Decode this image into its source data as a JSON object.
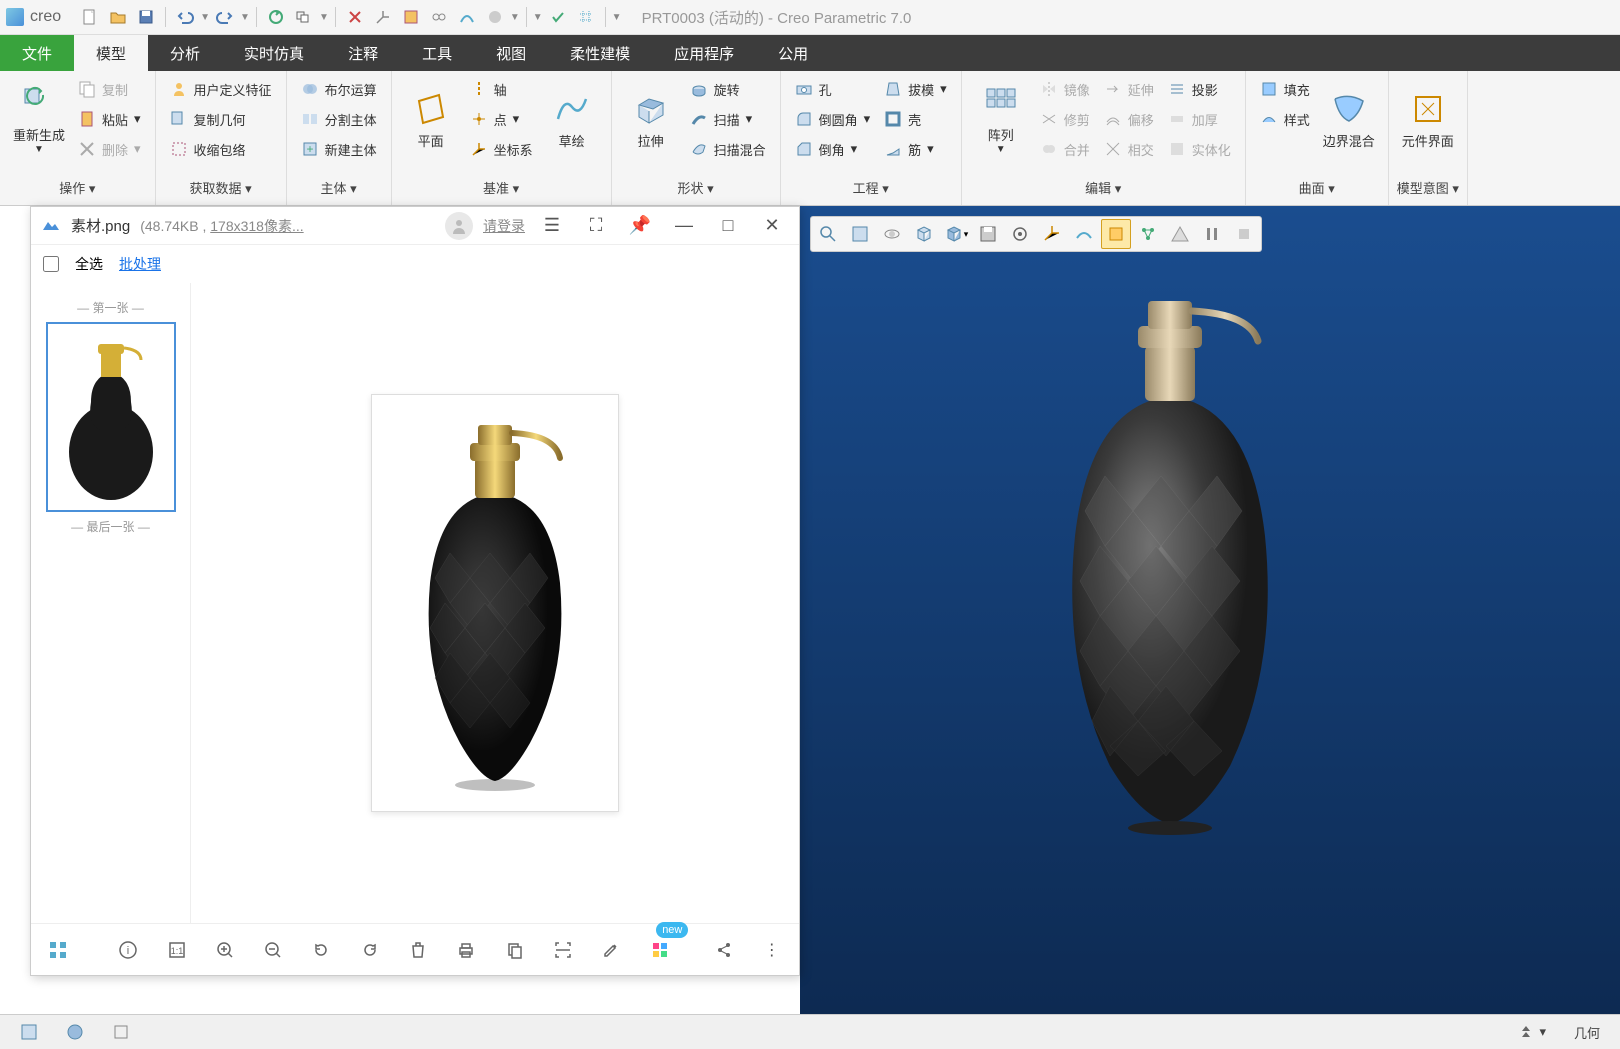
{
  "app": {
    "name": "creo",
    "docTitle": "PRT0003 (活动的) - Creo Parametric 7.0"
  },
  "tabs": {
    "file": "文件",
    "items": [
      "模型",
      "分析",
      "实时仿真",
      "注释",
      "工具",
      "视图",
      "柔性建模",
      "应用程序",
      "公用"
    ],
    "active": 0
  },
  "groups": {
    "op": {
      "title": "操作",
      "regen": "重新生成",
      "copy": "复制",
      "paste": "粘贴",
      "delete": "删除"
    },
    "get": {
      "title": "获取数据",
      "udf": "用户定义特征",
      "copygeom": "复制几何",
      "shrink": "收缩包络"
    },
    "body": {
      "title": "主体",
      "bool": "布尔运算",
      "split": "分割主体",
      "new": "新建主体"
    },
    "datum": {
      "title": "基准",
      "plane": "平面",
      "sketch": "草绘",
      "axis": "轴",
      "point": "点",
      "csys": "坐标系"
    },
    "shape": {
      "title": "形状",
      "extrude": "拉伸",
      "revolve": "旋转",
      "sweep": "扫描",
      "blend": "扫描混合"
    },
    "eng": {
      "title": "工程",
      "hole": "孔",
      "round": "倒圆角",
      "chamfer": "倒角",
      "draft": "拔模",
      "shell": "壳",
      "rib": "筋"
    },
    "edit": {
      "title": "编辑",
      "pattern": "阵列",
      "mirror": "镜像",
      "trim": "修剪",
      "merge": "合并",
      "extend": "延伸",
      "offset": "偏移",
      "intersect": "相交",
      "project": "投影",
      "thicken": "加厚",
      "solidify": "实体化"
    },
    "surf": {
      "title": "曲面",
      "fill": "填充",
      "style": "样式",
      "boundary": "边界混合"
    },
    "intent": {
      "title": "模型意图",
      "comp": "元件界面"
    }
  },
  "viewer": {
    "filename": "素材.png",
    "filesize": "(48.74KB",
    "fileres": "178x318像素...",
    "login": "请登录",
    "selectall": "全选",
    "batch": "批处理",
    "first": "第一张",
    "last": "最后一张",
    "new": "new"
  },
  "status": {
    "geom": "几何"
  }
}
